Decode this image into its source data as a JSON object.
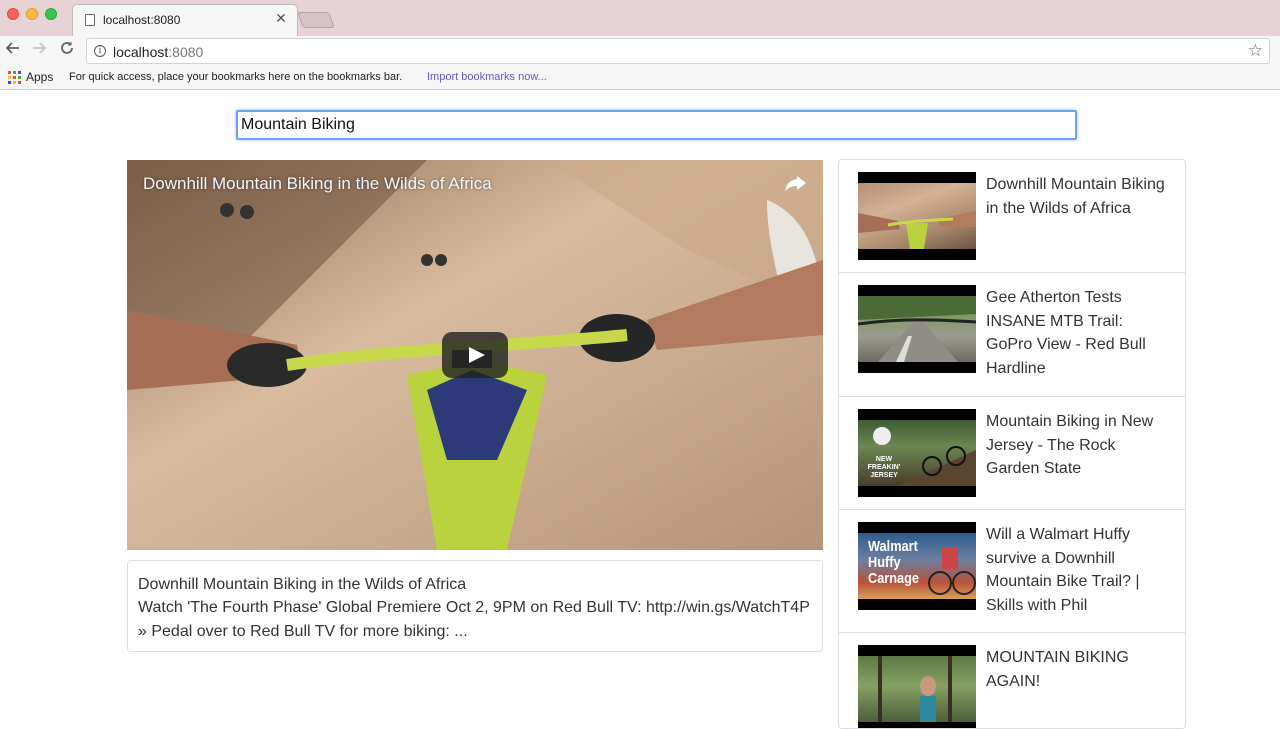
{
  "browser": {
    "tab_title": "localhost:8080",
    "tab_close": "✕",
    "url_host": "localhost",
    "url_port": ":8080",
    "bookmarks": {
      "apps_label": "Apps",
      "hint": "For quick access, place your bookmarks here on the bookmarks bar.",
      "import_link": "Import bookmarks now..."
    }
  },
  "search": {
    "value": "Mountain Biking"
  },
  "player": {
    "title": "Downhill Mountain Biking in the Wilds of Africa"
  },
  "details": {
    "title": "Downhill Mountain Biking in the Wilds of Africa",
    "description": "Watch 'The Fourth Phase' Global Premiere Oct 2, 9PM on Red Bull TV: http://win.gs/WatchT4P » Pedal over to Red Bull TV for more biking: ..."
  },
  "video_list": [
    {
      "title": "Downhill Mountain Biking in the Wilds of Africa"
    },
    {
      "title": "Gee Atherton Tests INSANE MTB Trail: GoPro View - Red Bull Hardline"
    },
    {
      "title": "Mountain Biking in New Jersey - The Rock Garden State",
      "thumb_text": "NEW FREAKIN' JERSEY"
    },
    {
      "title": "Will a Walmart Huffy survive a Downhill Mountain Bike Trail? | Skills with Phil",
      "thumb_text": "Walmart Huffy Carnage"
    },
    {
      "title": "MOUNTAIN BIKING AGAIN!"
    }
  ],
  "colors": {
    "focus_ring": "#6aa3ef",
    "link": "#6b59c6",
    "text": "#333333"
  },
  "icons": [
    "page-icon",
    "back-arrow-icon",
    "forward-arrow-icon",
    "reload-icon",
    "info-icon",
    "star-icon",
    "apps-grid-icon",
    "share-icon",
    "play-icon"
  ]
}
